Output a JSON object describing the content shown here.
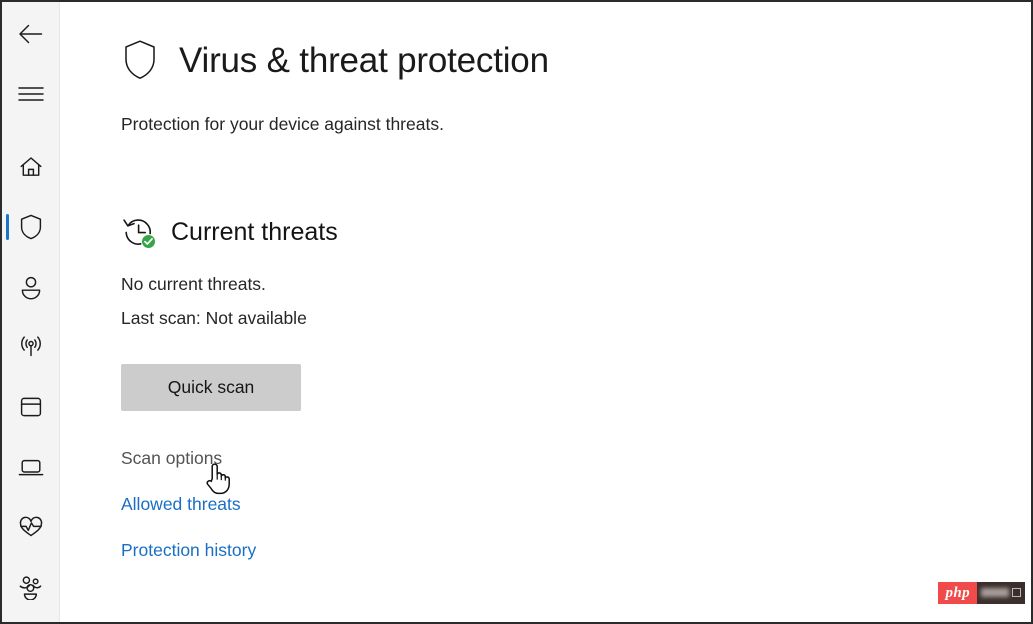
{
  "window": {
    "accent_color": "#1a74c8",
    "rail_background": "#f4f4f4",
    "content_background": "#ffffff"
  },
  "nav_rail": {
    "back_label": "Back",
    "menu_label": "Open navigation",
    "items": [
      {
        "label": "Home",
        "icon": "home-icon",
        "selected": false
      },
      {
        "label": "Virus & threat protection",
        "icon": "shield-icon",
        "selected": true
      },
      {
        "label": "Account protection",
        "icon": "person-icon",
        "selected": false
      },
      {
        "label": "Firewall & network protection",
        "icon": "antenna-icon",
        "selected": false
      },
      {
        "label": "App & browser control",
        "icon": "window-icon",
        "selected": false
      },
      {
        "label": "Device security",
        "icon": "laptop-icon",
        "selected": false
      },
      {
        "label": "Device performance & health",
        "icon": "heart-pulse-icon",
        "selected": false
      },
      {
        "label": "Family options",
        "icon": "family-icon",
        "selected": false
      }
    ]
  },
  "header": {
    "icon": "shield-icon",
    "title": "Virus & threat protection",
    "subtitle": "Protection for your device against threats."
  },
  "current_threats": {
    "icon": "history-clock-icon",
    "badge": "green-check-badge",
    "badge_color": "#36a54a",
    "title": "Current threats",
    "status": "No current threats.",
    "last_scan": "Last scan: Not available",
    "scan_button": "Quick scan",
    "links": [
      {
        "label": "Scan options",
        "style": "muted"
      },
      {
        "label": "Allowed threats",
        "style": "link"
      },
      {
        "label": "Protection history",
        "style": "link"
      }
    ]
  },
  "cursor": {
    "type": "pointer-hand-cursor"
  },
  "watermark": {
    "text": "php",
    "brand_color": "#f04a4a"
  }
}
